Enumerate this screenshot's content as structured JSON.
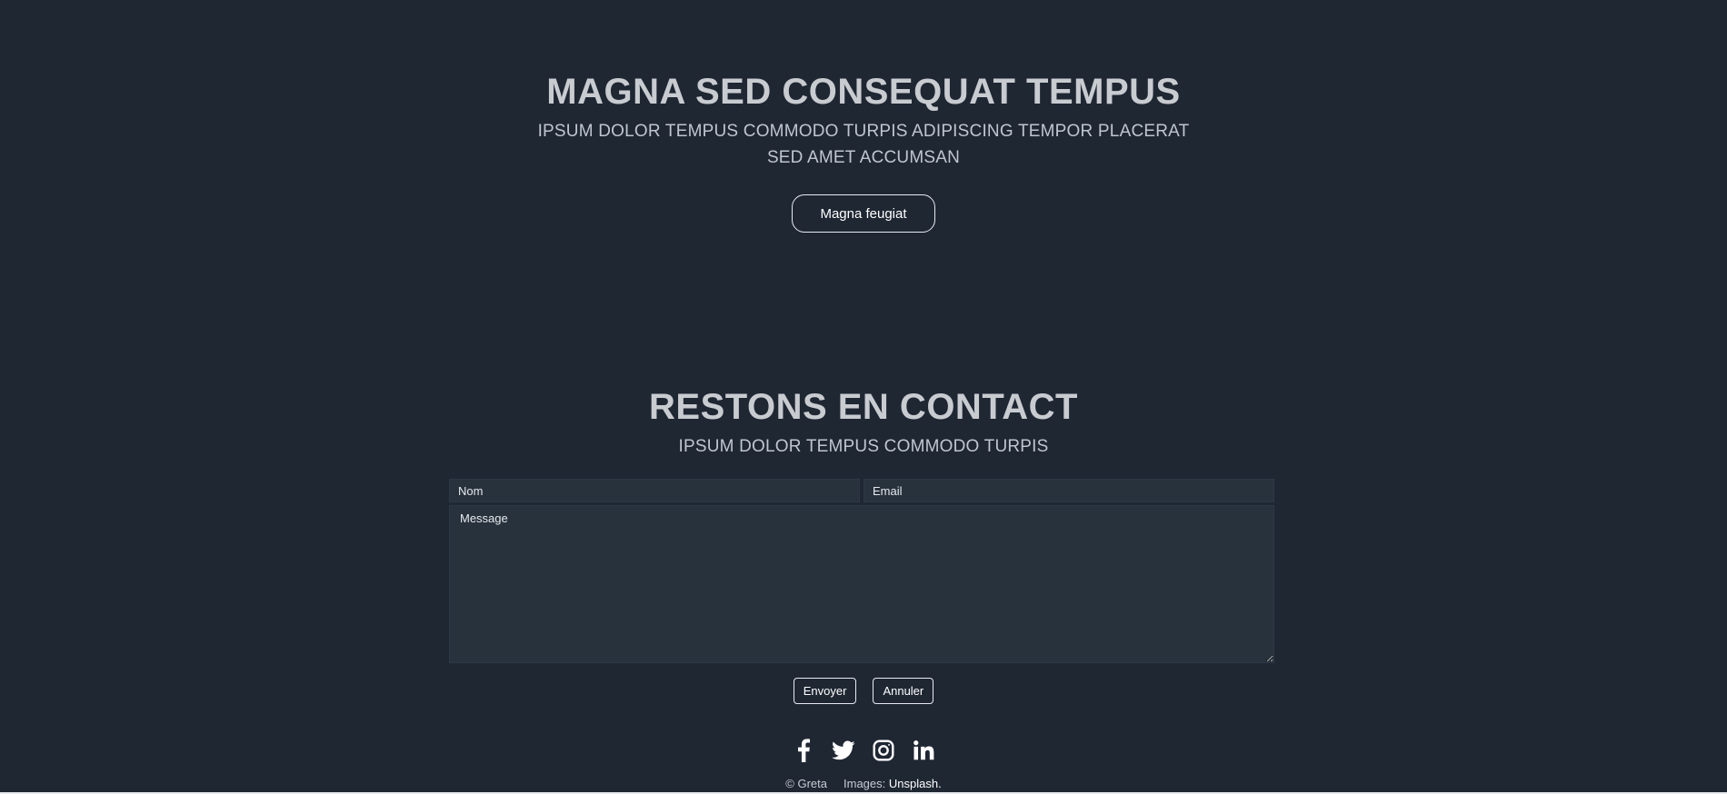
{
  "hero": {
    "title": "MAGNA SED CONSEQUAT TEMPUS",
    "subtitle": "IPSUM DOLOR TEMPUS COMMODO TURPIS ADIPISCING TEMPOR PLACERAT SED AMET ACCUMSAN",
    "button_label": "Magna feugiat"
  },
  "contact": {
    "title": "RESTONS EN CONTACT",
    "subtitle": "IPSUM DOLOR TEMPUS COMMODO TURPIS",
    "form": {
      "name_placeholder": "Nom",
      "email_placeholder": "Email",
      "message_placeholder": "Message",
      "submit_label": "Envoyer",
      "cancel_label": "Annuler"
    }
  },
  "social": {
    "icons": [
      "facebook-icon",
      "twitter-icon",
      "instagram-icon",
      "linkedin-icon"
    ]
  },
  "footer": {
    "copyright": "© Greta",
    "images_label": "Images:",
    "images_link": "Unsplash."
  },
  "colors": {
    "background": "#1f2733",
    "field_background": "#28323d",
    "text": "#c7ccd3",
    "white": "#ffffff"
  }
}
